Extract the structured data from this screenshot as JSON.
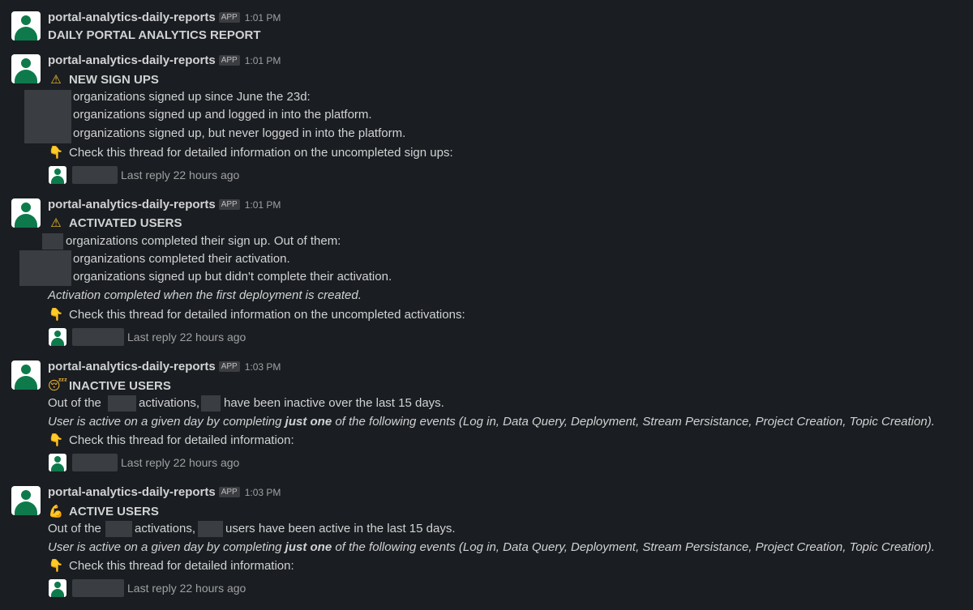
{
  "sender": "portal-analytics-daily-reports",
  "app_badge": "APP",
  "messages": [
    {
      "time": "1:01 PM",
      "title": "DAILY PORTAL ANALYTICS REPORT"
    },
    {
      "time": "1:01 PM",
      "title_icon": "warning-icon",
      "title": "NEW SIGN UPS",
      "lines": [
        "organizations signed up since June the 23d:",
        "organizations signed up and logged in into the platform.",
        "organizations signed up, but never logged in into the platform."
      ],
      "check": "Check this thread for detailed information on the uncompleted sign ups:",
      "reply": "Last reply 22 hours ago"
    },
    {
      "time": "1:01 PM",
      "title_icon": "warning-icon",
      "title": "ACTIVATED USERS",
      "lines": [
        "organizations completed their sign up. Out of them:",
        "organizations completed their activation.",
        "organizations signed up but didn't complete their activation."
      ],
      "note": "Activation completed when the first deployment is created.",
      "check": "Check this thread for detailed information on the uncompleted activations:",
      "reply": "Last reply 22 hours ago"
    },
    {
      "time": "1:03 PM",
      "title_icon": "sleepy-face-icon",
      "title": "INACTIVE USERS",
      "line_parts": [
        "Out of the",
        "activations,",
        "have been inactive over the last 15 days."
      ],
      "note_parts": [
        "User is active on a given day by completing ",
        "just one",
        " of the following events (Log in, Data Query, Deployment, Stream Persistance, Project Creation, Topic Creation)."
      ],
      "check": "Check this thread for detailed information:",
      "reply": "Last reply 22 hours ago"
    },
    {
      "time": "1:03 PM",
      "title_icon": "flexed-biceps-icon",
      "title": "ACTIVE USERS",
      "line_parts": [
        "Out of the",
        "activations,",
        "users have been active in the last 15 days."
      ],
      "note_parts": [
        "User is active on a given day by completing ",
        "just one",
        " of the following events (Log in, Data Query, Deployment, Stream Persistance, Project Creation, Topic Creation)."
      ],
      "check": "Check this thread for detailed information:",
      "reply": "Last reply 22 hours ago"
    }
  ]
}
